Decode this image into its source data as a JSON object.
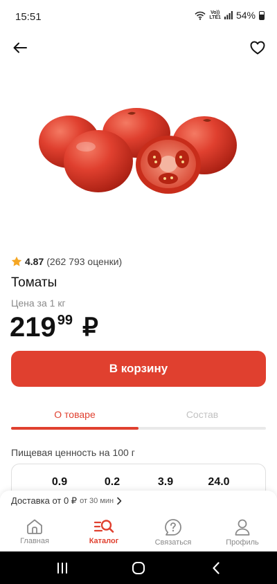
{
  "status": {
    "time": "15:51",
    "vol": "Vo))",
    "lte": "LTE1",
    "battery": "54%"
  },
  "product": {
    "rating": "4.87",
    "rating_count": "(262 793 оценки)",
    "title": "Томаты",
    "price_label": "Цена за 1 кг",
    "price_int": "219",
    "price_dec": "99",
    "currency": "₽",
    "cart_button": "В корзину"
  },
  "tabs": [
    {
      "label": "О товаре",
      "active": true
    },
    {
      "label": "Состав",
      "active": false
    }
  ],
  "nutrition": {
    "title": "Пищевая ценность на 100 г",
    "values": [
      "0.9",
      "0.2",
      "3.9",
      "24.0"
    ]
  },
  "delivery": {
    "main": "Доставка от 0 ₽",
    "time": "от 30 мин"
  },
  "nav": [
    {
      "label": "Главная",
      "icon": "home-icon",
      "active": false
    },
    {
      "label": "Каталог",
      "icon": "catalog-icon",
      "active": true
    },
    {
      "label": "Связаться",
      "icon": "help-icon",
      "active": false
    },
    {
      "label": "Профиль",
      "icon": "profile-icon",
      "active": false
    }
  ],
  "colors": {
    "accent": "#e0402f",
    "tomato": "#d63a25"
  }
}
